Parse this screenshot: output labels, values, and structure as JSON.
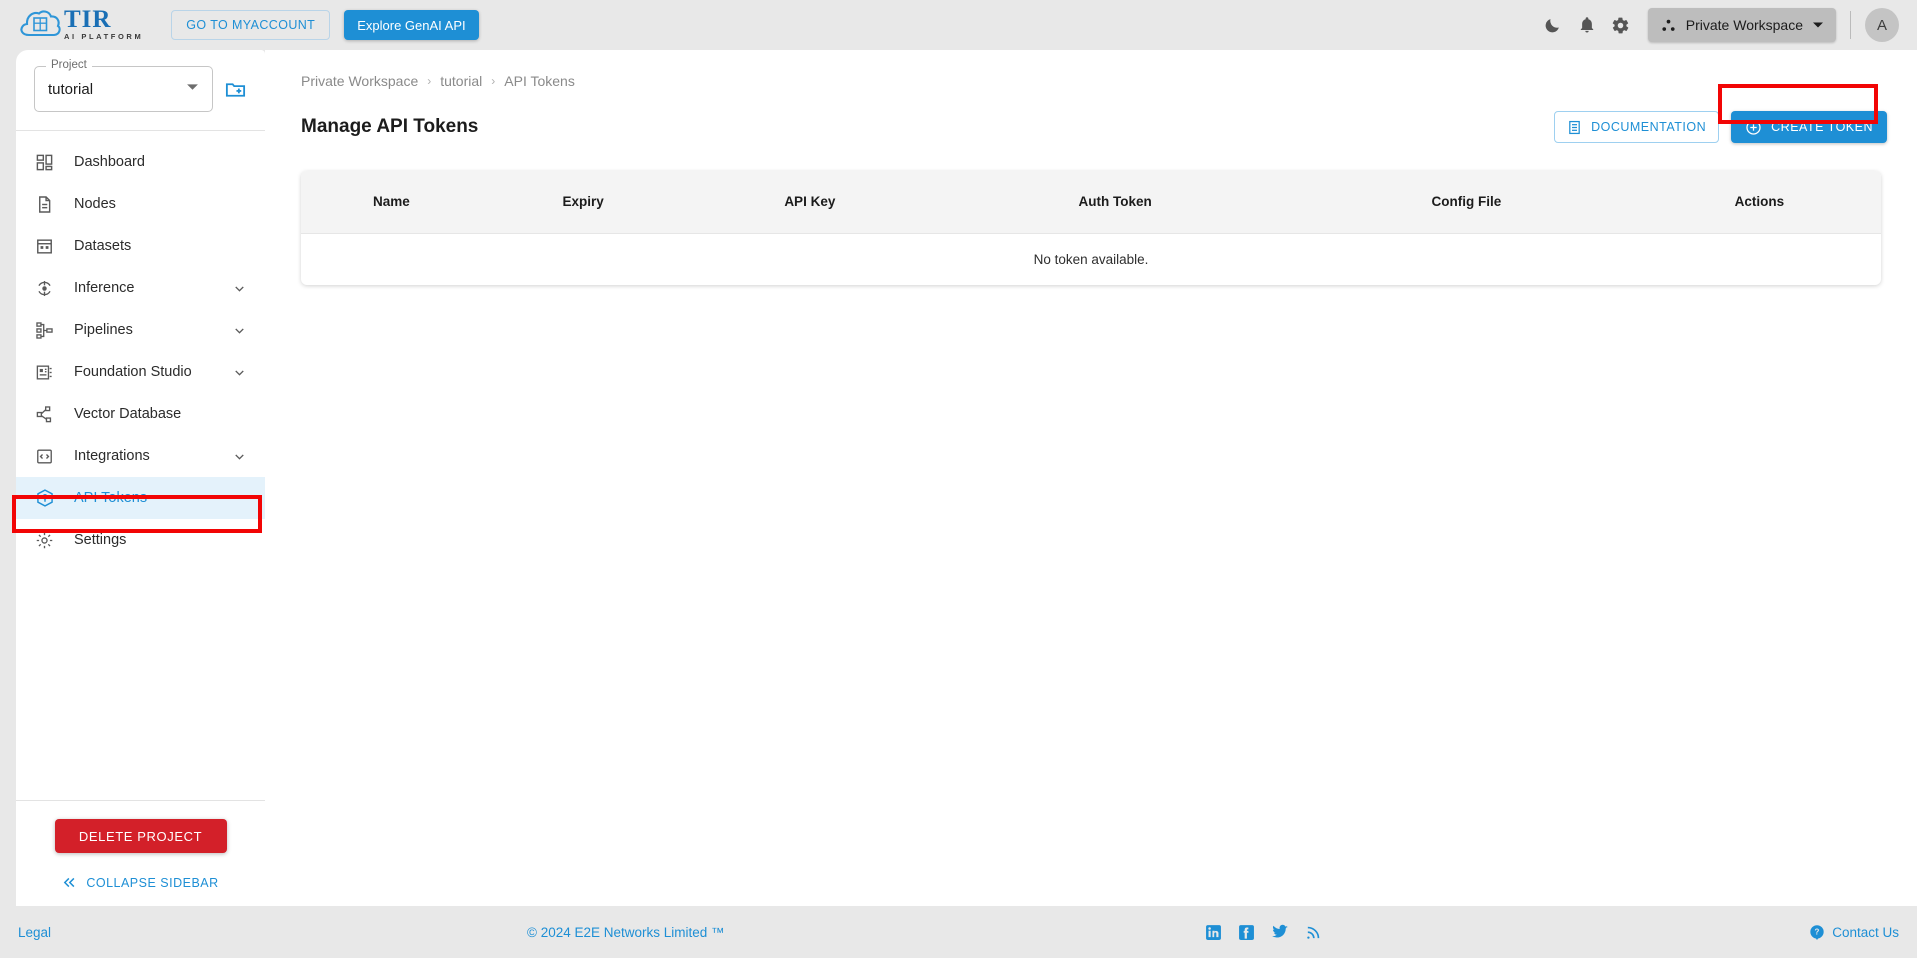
{
  "topbar": {
    "logo": {
      "name": "TIR",
      "subtitle": "AI PLATFORM",
      "icon": "tir-cloud-logo"
    },
    "myaccount_label": "GO TO MYACCOUNT",
    "genai_label": "Explore GenAI API",
    "icons": {
      "dark_mode": "moon-icon",
      "notifications": "bell-icon",
      "settings": "gear-icon",
      "workspace": "workspace-icon",
      "caret": "chevron-down-icon"
    },
    "workspace_label": "Private Workspace",
    "avatar_initial": "A"
  },
  "sidebar": {
    "project": {
      "label": "Project",
      "value": "tutorial",
      "new_project_icon": "new-folder-icon"
    },
    "items": [
      {
        "label": "Dashboard",
        "icon": "dashboard-icon",
        "expandable": false,
        "active": false
      },
      {
        "label": "Nodes",
        "icon": "document-icon",
        "expandable": false,
        "active": false
      },
      {
        "label": "Datasets",
        "icon": "datasets-grid-icon",
        "expandable": false,
        "active": false
      },
      {
        "label": "Inference",
        "icon": "inference-icon",
        "expandable": true,
        "active": false
      },
      {
        "label": "Pipelines",
        "icon": "pipelines-icon",
        "expandable": true,
        "active": false
      },
      {
        "label": "Foundation Studio",
        "icon": "foundation-studio-icon",
        "expandable": true,
        "active": false
      },
      {
        "label": "Vector Database",
        "icon": "vector-database-icon",
        "expandable": false,
        "active": false
      },
      {
        "label": "Integrations",
        "icon": "integrations-code-icon",
        "expandable": true,
        "active": false
      },
      {
        "label": "API Tokens",
        "icon": "api-token-icon",
        "expandable": false,
        "active": true
      },
      {
        "label": "Settings",
        "icon": "settings-gear-icon",
        "expandable": false,
        "active": false
      }
    ],
    "delete_project_label": "DELETE PROJECT",
    "collapse_label": "COLLAPSE SIDEBAR",
    "collapse_icon": "double-chevron-left-icon"
  },
  "main": {
    "breadcrumb": [
      "Private Workspace",
      "tutorial",
      "API Tokens"
    ],
    "page_title": "Manage API Tokens",
    "documentation_label": "DOCUMENTATION",
    "documentation_icon": "document-list-icon",
    "create_token_label": "CREATE TOKEN",
    "create_token_icon": "plus-circle-icon",
    "table": {
      "columns": [
        "Name",
        "Expiry",
        "API Key",
        "Auth Token",
        "Config File",
        "Actions"
      ],
      "rows": [],
      "empty_message": "No token available."
    }
  },
  "footer": {
    "legal": "Legal",
    "copyright": "© 2024 E2E Networks Limited ™",
    "social": [
      "linkedin-icon",
      "facebook-icon",
      "twitter-icon",
      "rss-icon"
    ],
    "contact": "Contact Us",
    "contact_icon": "question-circle-icon"
  },
  "colors": {
    "accent": "#1e8fd5",
    "danger": "#d32029",
    "annotation": "#f20505",
    "page_bg": "#e8e8e8",
    "active_nav_bg": "#e4f2fb"
  }
}
